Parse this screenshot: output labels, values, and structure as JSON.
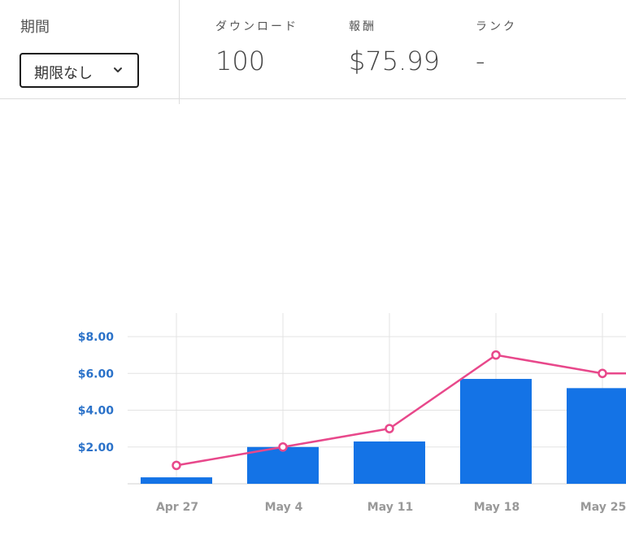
{
  "header": {
    "period": {
      "label": "期間",
      "selected": "期限なし"
    },
    "stats": [
      {
        "label": "ダウンロード",
        "value": "100"
      },
      {
        "label": "報酬",
        "value": "$75.99"
      },
      {
        "label": "ランク",
        "value": "-"
      }
    ]
  },
  "colors": {
    "bar": "#1473e6",
    "line": "#e8488b",
    "axis_tick_y": "#2b72c9",
    "axis_tick_x": "#999999",
    "grid": "#e3e3e3"
  },
  "chart_data": {
    "type": "bar",
    "categories": [
      "Apr 27",
      "May 4",
      "May 11",
      "May 18",
      "May 25"
    ],
    "series": [
      {
        "type": "bar",
        "values": [
          0.35,
          2.0,
          2.3,
          5.7,
          5.2
        ]
      },
      {
        "type": "line",
        "values": [
          1.0,
          2.0,
          3.0,
          7.0,
          6.0
        ]
      }
    ],
    "y_ticks": [
      "$2.00",
      "$4.00",
      "$6.00",
      "$8.00"
    ],
    "ylim": [
      0,
      8
    ],
    "grid": true,
    "legend": false
  }
}
